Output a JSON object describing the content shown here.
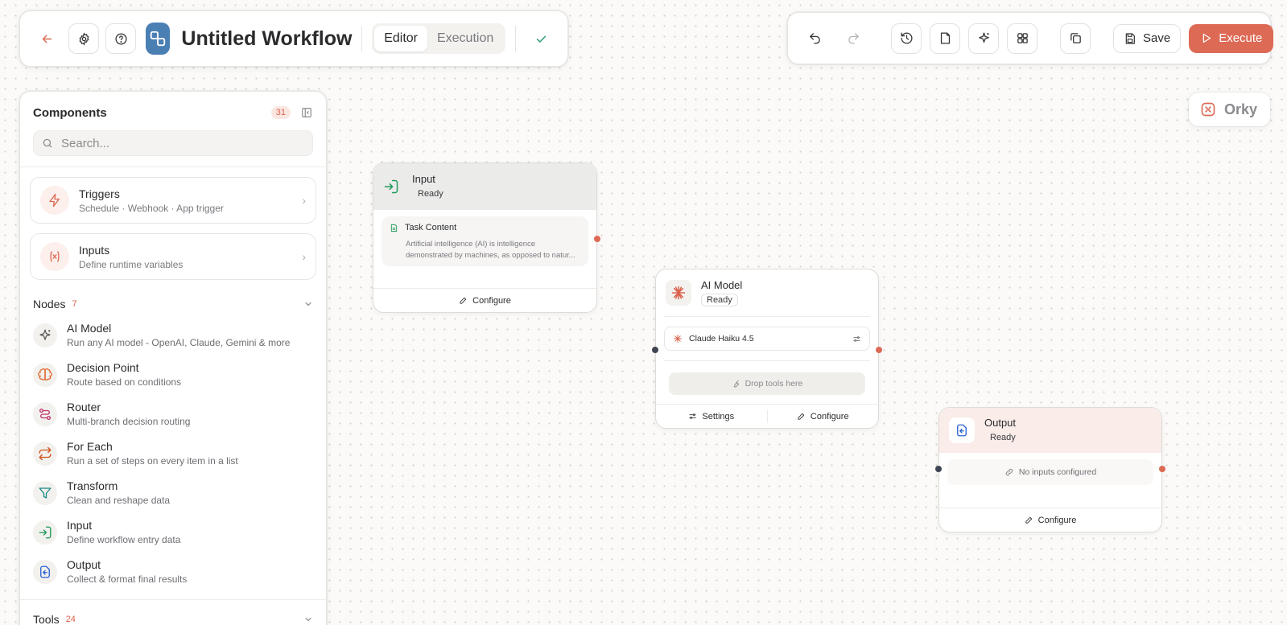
{
  "header": {
    "title": "Untitled Workflow",
    "tabs": [
      {
        "label": "Editor",
        "active": true
      },
      {
        "label": "Execution",
        "active": false
      }
    ]
  },
  "toolbar": {
    "save_label": "Save",
    "execute_label": "Execute"
  },
  "brand": {
    "name": "Orky"
  },
  "colors": {
    "accent": "#dd6a55",
    "logo_bg": "#4a7fb4"
  },
  "sidebar": {
    "title": "Components",
    "count": "31",
    "search_placeholder": "Search...",
    "cards": [
      {
        "title": "Triggers",
        "subtitle": "Schedule · Webhook · App trigger",
        "icon": "lightning-icon"
      },
      {
        "title": "Inputs",
        "subtitle": "Define runtime variables",
        "icon": "variable-icon"
      }
    ],
    "nodes_section": {
      "title": "Nodes",
      "count": "7"
    },
    "nodes": [
      {
        "title": "AI Model",
        "subtitle": "Run any AI model - OpenAI, Claude, Gemini & more",
        "icon": "sparkle-icon"
      },
      {
        "title": "Decision Point",
        "subtitle": "Route based on conditions",
        "icon": "brain-icon"
      },
      {
        "title": "Router",
        "subtitle": "Multi-branch decision routing",
        "icon": "route-icon"
      },
      {
        "title": "For Each",
        "subtitle": "Run a set of steps on every item in a list",
        "icon": "repeat-icon"
      },
      {
        "title": "Transform",
        "subtitle": "Clean and reshape data",
        "icon": "filter-icon"
      },
      {
        "title": "Input",
        "subtitle": "Define workflow entry data",
        "icon": "input-icon"
      },
      {
        "title": "Output",
        "subtitle": "Collect & format final results",
        "icon": "output-icon"
      }
    ],
    "tools_section": {
      "title": "Tools",
      "count": "24"
    }
  },
  "canvas": {
    "input_node": {
      "title": "Input",
      "status": "Ready",
      "field_label": "Task Content",
      "field_preview": "Artificial intelligence (AI) is intelligence demonstrated by machines, as opposed to natur...",
      "configure_label": "Configure"
    },
    "ai_node": {
      "title": "AI Model",
      "status": "Ready",
      "model": "Claude Haiku 4.5",
      "drop_label": "Drop tools here",
      "settings_label": "Settings",
      "configure_label": "Configure"
    },
    "output_node": {
      "title": "Output",
      "status": "Ready",
      "empty_label": "No inputs configured",
      "configure_label": "Configure"
    }
  }
}
